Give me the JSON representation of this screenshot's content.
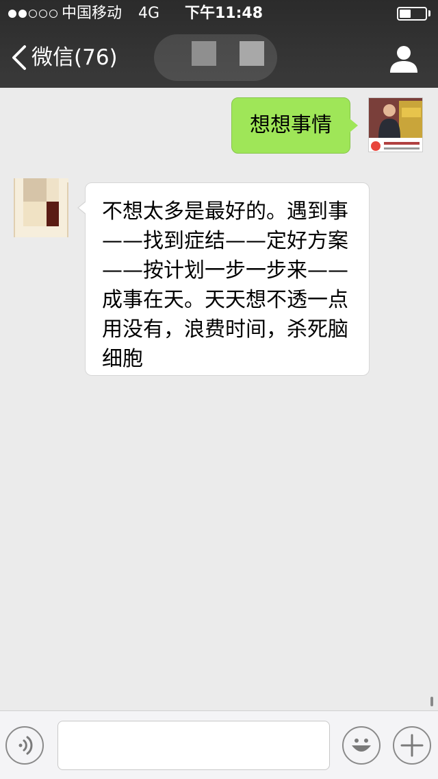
{
  "status_bar": {
    "signal_strength": 2,
    "signal_total": 5,
    "carrier": "中国移动",
    "network": "4G",
    "time": "下午11:48",
    "battery_level": 0.45
  },
  "nav": {
    "back_label": "微信(76)",
    "back_icon": "chevron-left-icon",
    "profile_icon": "person-icon"
  },
  "messages": [
    {
      "direction": "outgoing",
      "text": "想想事情"
    },
    {
      "direction": "incoming",
      "text": "不想太多是最好的。遇到事——找到症结——定好方案——按计划一步一步来——成事在天。天天想不透一点用没有，浪费时间，杀死脑细胞"
    }
  ],
  "input_bar": {
    "voice_icon": "voice-icon",
    "text_value": "",
    "emoji_icon": "smiley-icon",
    "plus_icon": "plus-icon"
  },
  "colors": {
    "header_bg": "#2b2b2b",
    "chat_bg": "#ebebeb",
    "outgoing_bubble": "#9fe658",
    "incoming_bubble": "#ffffff"
  }
}
